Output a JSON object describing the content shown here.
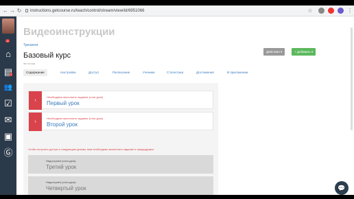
{
  "browser": {
    "url": "instructions.getcourse.ru/teach/control/stream/view/id/6951066",
    "back_icon": "arrow-left-icon",
    "forward_icon": "arrow-right-icon",
    "reload_icon": "reload-icon"
  },
  "sidebar": {
    "avatar_badge": "11",
    "items": [
      {
        "icon": "home-icon",
        "glyph": "⌂"
      },
      {
        "icon": "chart-icon",
        "glyph": "▤",
        "badge": "1"
      },
      {
        "icon": "users-icon",
        "glyph": "👥"
      },
      {
        "icon": "tasks-icon",
        "glyph": "☑"
      },
      {
        "icon": "mail-icon",
        "glyph": "✉"
      },
      {
        "icon": "store-icon",
        "glyph": "▣"
      },
      {
        "icon": "getcourse-icon",
        "glyph": "Ⓖ"
      }
    ]
  },
  "header": {
    "page_title": "Видеоинструкции",
    "breadcrumb": "Тренинги",
    "course_title": "Базовый курс",
    "course_subtitle": "нет потока",
    "actions_label": "Действия ▾",
    "add_label": "+ Добавить ▾"
  },
  "tabs": [
    {
      "label": "Содержание",
      "active": true
    },
    {
      "label": "Настройка"
    },
    {
      "label": "Доступ"
    },
    {
      "label": "Расписание"
    },
    {
      "label": "Ученики"
    },
    {
      "label": "Статистика"
    },
    {
      "label": "Достижения"
    },
    {
      "label": "В приложении"
    }
  ],
  "lessons": [
    {
      "requirement": "Необходимо выполнить задание (стоп-урок)",
      "name": "Первый урок"
    },
    {
      "requirement": "Необходимо выполнить задание (стоп-урок)",
      "name": "Второй урок"
    }
  ],
  "warning": "Чтобы получить доступ к следующим урокам, вам необходимо выполнить задание в предыдущем",
  "locked_lessons": [
    {
      "status": "Недоступен (стоп-урок)",
      "name": "Третий урок"
    },
    {
      "status": "Недоступен (стоп-урок)",
      "name": "Четвертый урок"
    }
  ],
  "colors": {
    "sidebar": "#2b3a4a",
    "accent_red": "#d9434b",
    "link_blue": "#3a7bbf",
    "add_green": "#5cb85c",
    "actions_gray": "#999999"
  }
}
